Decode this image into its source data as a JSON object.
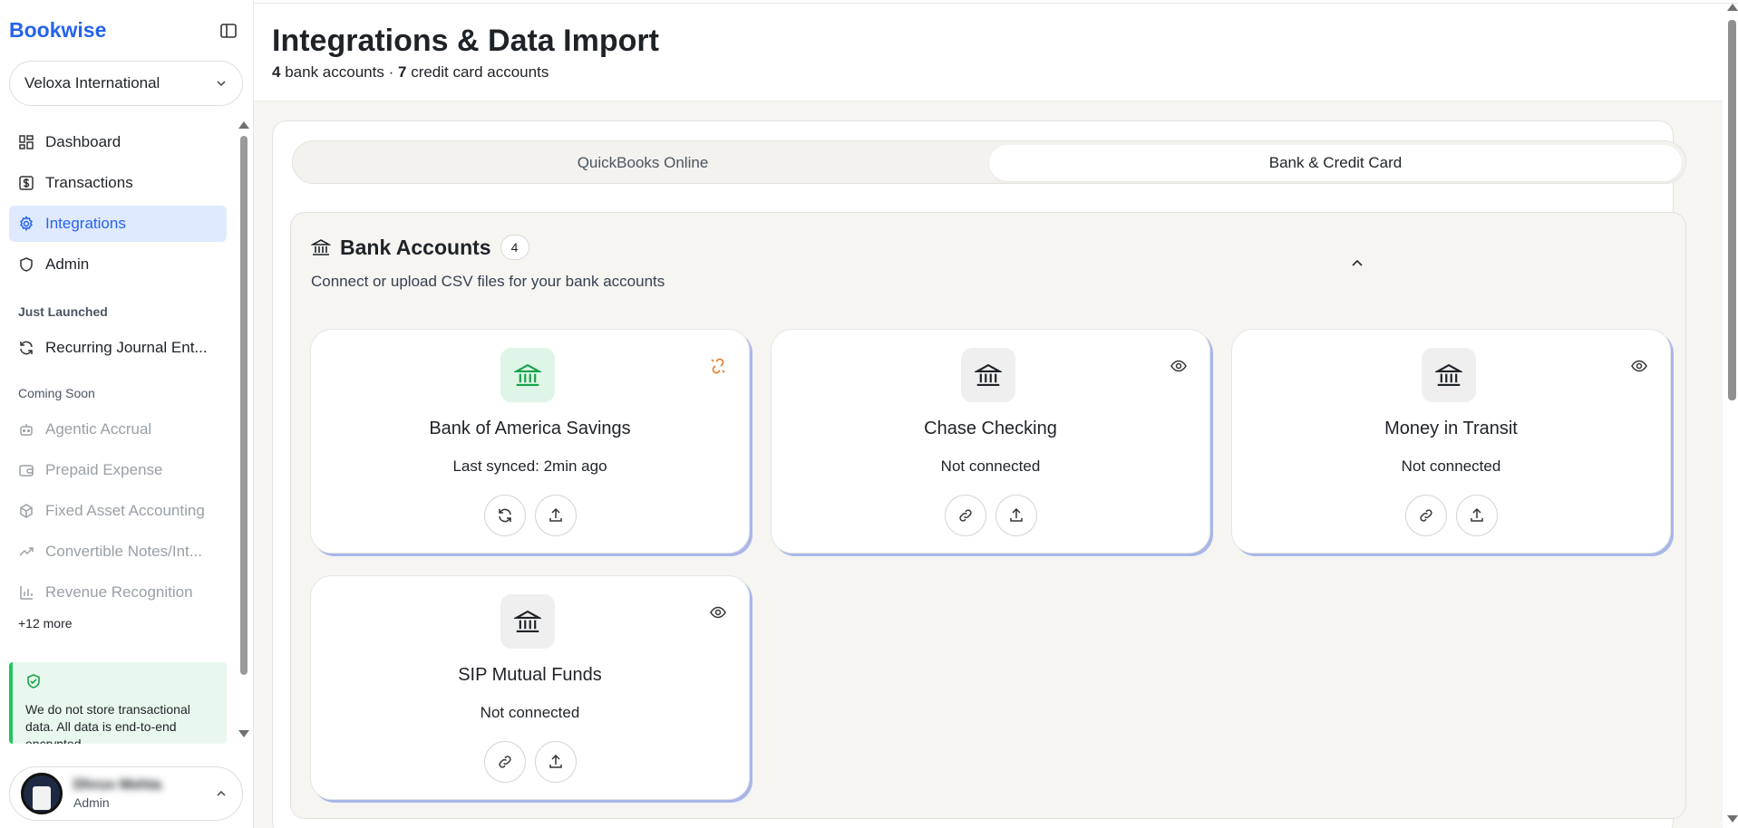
{
  "sidebar": {
    "brand": "Bookwise",
    "org_name": "Veloxa International",
    "nav": [
      {
        "label": "Dashboard",
        "icon": "dashboard-icon"
      },
      {
        "label": "Transactions",
        "icon": "dollar-icon"
      },
      {
        "label": "Integrations",
        "icon": "gear-icon",
        "active": true
      },
      {
        "label": "Admin",
        "icon": "shield-icon"
      }
    ],
    "just_launched_label": "Just Launched",
    "just_launched": [
      {
        "label": "Recurring Journal Ent...",
        "icon": "refresh-icon"
      }
    ],
    "coming_soon_label": "Coming Soon",
    "coming_soon": [
      {
        "label": "Agentic Accrual",
        "icon": "bot-icon"
      },
      {
        "label": "Prepaid Expense",
        "icon": "wallet-icon"
      },
      {
        "label": "Fixed Asset Accounting",
        "icon": "box-icon"
      },
      {
        "label": "Convertible Notes/Int...",
        "icon": "trend-icon"
      },
      {
        "label": "Revenue Recognition",
        "icon": "bar-chart-icon"
      }
    ],
    "more_label": "+12 more",
    "security_note": "We do not store transactional data. All data is end-to-end encrypted.",
    "user": {
      "name": "Dhruv Mehta",
      "role": "Admin"
    }
  },
  "header": {
    "title": "Integrations & Data Import",
    "bank_count": "4",
    "bank_label": "bank accounts",
    "separator": "·",
    "card_count": "7",
    "card_label": "credit card accounts"
  },
  "tabs": [
    {
      "label": "QuickBooks Online",
      "selected": false
    },
    {
      "label": "Bank & Credit Card",
      "selected": true
    }
  ],
  "bank_section": {
    "title": "Bank Accounts",
    "count": "4",
    "description": "Connect or upload CSV files for your bank accounts",
    "accounts": [
      {
        "name": "Bank of America Savings",
        "status": "Last synced: 2min ago",
        "connected": true
      },
      {
        "name": "Chase Checking",
        "status": "Not connected",
        "connected": false
      },
      {
        "name": "Money in Transit",
        "status": "Not connected",
        "connected": false
      },
      {
        "name": "SIP Mutual Funds",
        "status": "Not connected",
        "connected": false
      }
    ]
  },
  "colors": {
    "brand": "#2563eb",
    "active_nav_bg": "#e0eaff",
    "connected_green": "#16a34a",
    "disconnect_orange": "#ea7a2c",
    "card_shadow": "#a9b6e8"
  }
}
